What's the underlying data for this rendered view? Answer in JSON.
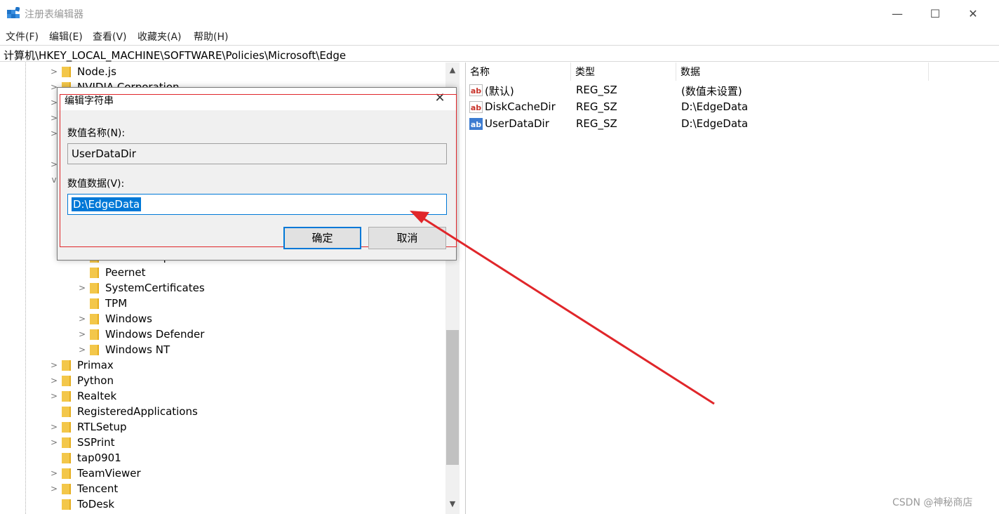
{
  "window": {
    "title": "注册表编辑器"
  },
  "window_controls": {
    "minimize": "—",
    "maximize": "☐",
    "close": "✕"
  },
  "menu": [
    "文件(F)",
    "编辑(E)",
    "查看(V)",
    "收藏夹(A)",
    "帮助(H)"
  ],
  "address": "计算机\\HKEY_LOCAL_MACHINE\\SOFTWARE\\Policies\\Microsoft\\Edge",
  "tree": {
    "partial_top": [
      "Node.js",
      "NVIDIA Corporation"
    ],
    "partial_under_dialog": "Internet Explorer",
    "children": [
      {
        "label": "Peernet",
        "expandable": false
      },
      {
        "label": "SystemCertificates",
        "expandable": true
      },
      {
        "label": "TPM",
        "expandable": false
      },
      {
        "label": "Windows",
        "expandable": true
      },
      {
        "label": "Windows Defender",
        "expandable": true
      },
      {
        "label": "Windows NT",
        "expandable": true
      }
    ],
    "items": [
      {
        "label": "Primax",
        "expandable": true
      },
      {
        "label": "Python",
        "expandable": true
      },
      {
        "label": "Realtek",
        "expandable": true
      },
      {
        "label": "RegisteredApplications",
        "expandable": false
      },
      {
        "label": "RTLSetup",
        "expandable": true
      },
      {
        "label": "SSPrint",
        "expandable": true
      },
      {
        "label": "tap0901",
        "expandable": false
      },
      {
        "label": "TeamViewer",
        "expandable": true
      },
      {
        "label": "Tencent",
        "expandable": true
      },
      {
        "label": "ToDesk",
        "expandable": false
      }
    ]
  },
  "list": {
    "headers": {
      "name": "名称",
      "type": "类型",
      "data": "数据"
    },
    "rows": [
      {
        "name": "(默认)",
        "type": "REG_SZ",
        "data": "(数值未设置)",
        "icon": "ab-string-icon",
        "icon_text": "ab"
      },
      {
        "name": "DiskCacheDir",
        "type": "REG_SZ",
        "data": "D:\\EdgeData",
        "icon": "ab-string-icon",
        "icon_text": "ab"
      },
      {
        "name": "UserDataDir",
        "type": "REG_SZ",
        "data": "D:\\EdgeData",
        "icon": "ab-string-icon",
        "icon_text": "ab"
      }
    ]
  },
  "dialog": {
    "title": "编辑字符串",
    "close": "✕",
    "name_label": "数值名称(N):",
    "name_value": "UserDataDir",
    "data_label": "数值数据(V):",
    "data_value": "D:\\EdgeData",
    "ok_label": "确定",
    "cancel_label": "取消"
  },
  "watermark": "CSDN @神秘商店",
  "colors": {
    "annotation": "#e0262a",
    "selection": "#0078d7",
    "folder": "#f3c74a"
  }
}
